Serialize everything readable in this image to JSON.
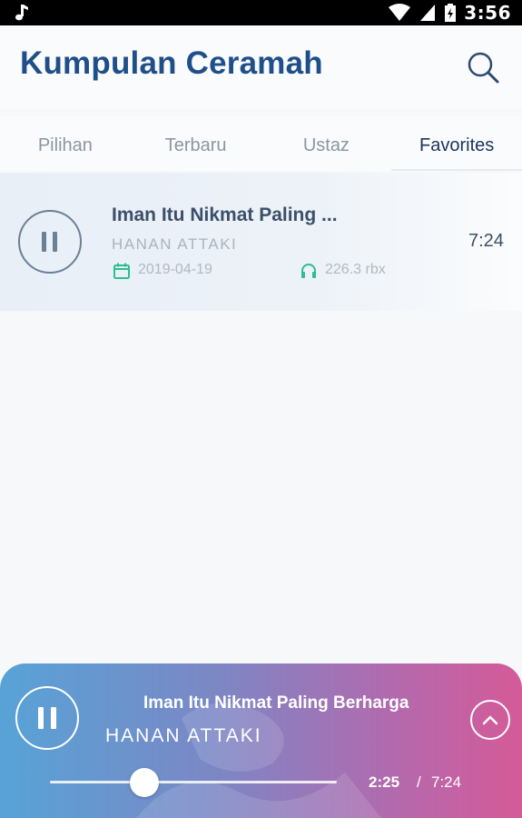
{
  "status_bar": {
    "time": "3:56",
    "icons": [
      "music-note-icon",
      "wifi-icon",
      "signal-icon",
      "battery-icon"
    ]
  },
  "header": {
    "title": "Kumpulan Ceramah",
    "search_icon": "search-icon"
  },
  "tabs": [
    {
      "label": "Pilihan",
      "active": false
    },
    {
      "label": "Terbaru",
      "active": false
    },
    {
      "label": "Ustaz",
      "active": false
    },
    {
      "label": "Favorites",
      "active": true
    }
  ],
  "list": {
    "items": [
      {
        "title": "Iman Itu Nikmat Paling ...",
        "artist": "HANAN ATTAKI",
        "date": "2019-04-19",
        "listens": "226.3 rbx",
        "duration": "7:24",
        "state_icon": "pause-icon"
      }
    ]
  },
  "player": {
    "title": "Iman Itu Nikmat Paling Berharga",
    "artist": "HANAN ATTAKI",
    "current_time": "2:25",
    "separator": "/",
    "total_time": "7:24",
    "progress_fraction": 0.33,
    "state_icon": "pause-icon",
    "expand_icon": "chevron-up-icon"
  },
  "colors": {
    "title_blue": "#1f4f8a",
    "accent_green": "#2bbf8f",
    "player_gradient_start": "#57a3d6",
    "player_gradient_end": "#d55a98"
  }
}
